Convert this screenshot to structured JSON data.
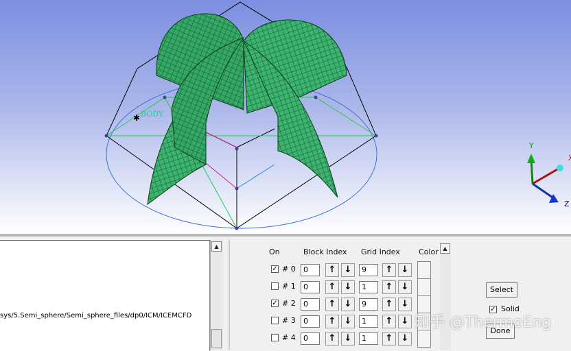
{
  "viewport": {
    "body_label": "BODY",
    "axes": {
      "y": "Y",
      "x": "X",
      "z": "Z"
    }
  },
  "log": {
    "line": "sys/5.Semi_sphere/Semi_sphere_files/dp0/ICM/ICEMCFD"
  },
  "table": {
    "headers": {
      "on": "On",
      "block_index": "Block Index",
      "grid_index": "Grid Index",
      "color": "Color"
    },
    "rows": [
      {
        "label": "# 0",
        "on": true,
        "block": "0",
        "grid": "9"
      },
      {
        "label": "# 1",
        "on": false,
        "block": "0",
        "grid": "1"
      },
      {
        "label": "# 2",
        "on": true,
        "block": "0",
        "grid": "9"
      },
      {
        "label": "# 3",
        "on": false,
        "block": "0",
        "grid": "1"
      },
      {
        "label": "# 4",
        "on": false,
        "block": "0",
        "grid": "1"
      }
    ]
  },
  "controls": {
    "select_label": "Select",
    "solid_label": "Solid",
    "solid_checked": true,
    "done_label": "Done"
  },
  "watermark": "知乎 @ThermoEng",
  "icons": {
    "up": "arrow-up-icon",
    "down": "arrow-down-icon",
    "check": "check-icon"
  },
  "colors": {
    "mesh": "#3cb371",
    "mesh_lines": "#0c3d14",
    "viewport_top": "#7c8fe0"
  }
}
